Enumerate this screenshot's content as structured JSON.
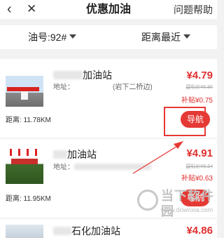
{
  "header": {
    "back_icon": "‹",
    "close_icon": "✕",
    "title": "优惠加油",
    "help": "问题帮助"
  },
  "filters": {
    "oil_type": "油号:92#",
    "sort": "距离最近"
  },
  "stations": [
    {
      "name": "加油站",
      "address": "地址：　　　　　　(岩下二桥边)",
      "price": "¥4.79",
      "standard_price": "国标价¥5.90",
      "subsidy": "补贴¥0.75",
      "distance": "距离: 11.78KM",
      "nav_label": "导航"
    },
    {
      "name": "加油站",
      "address": "地址：",
      "price": "¥4.91",
      "standard_price": "国标价¥5.54",
      "subsidy": "补贴¥0.63",
      "distance": "距离: 11.95KM",
      "nav_label": "导航"
    },
    {
      "name": "石化加油站",
      "price": "¥4.86"
    }
  ],
  "watermark": {
    "brand": "当下软件园",
    "url": "www.downxia.com"
  },
  "colors": {
    "accent": "#e53935",
    "price": "#e02e2e"
  }
}
